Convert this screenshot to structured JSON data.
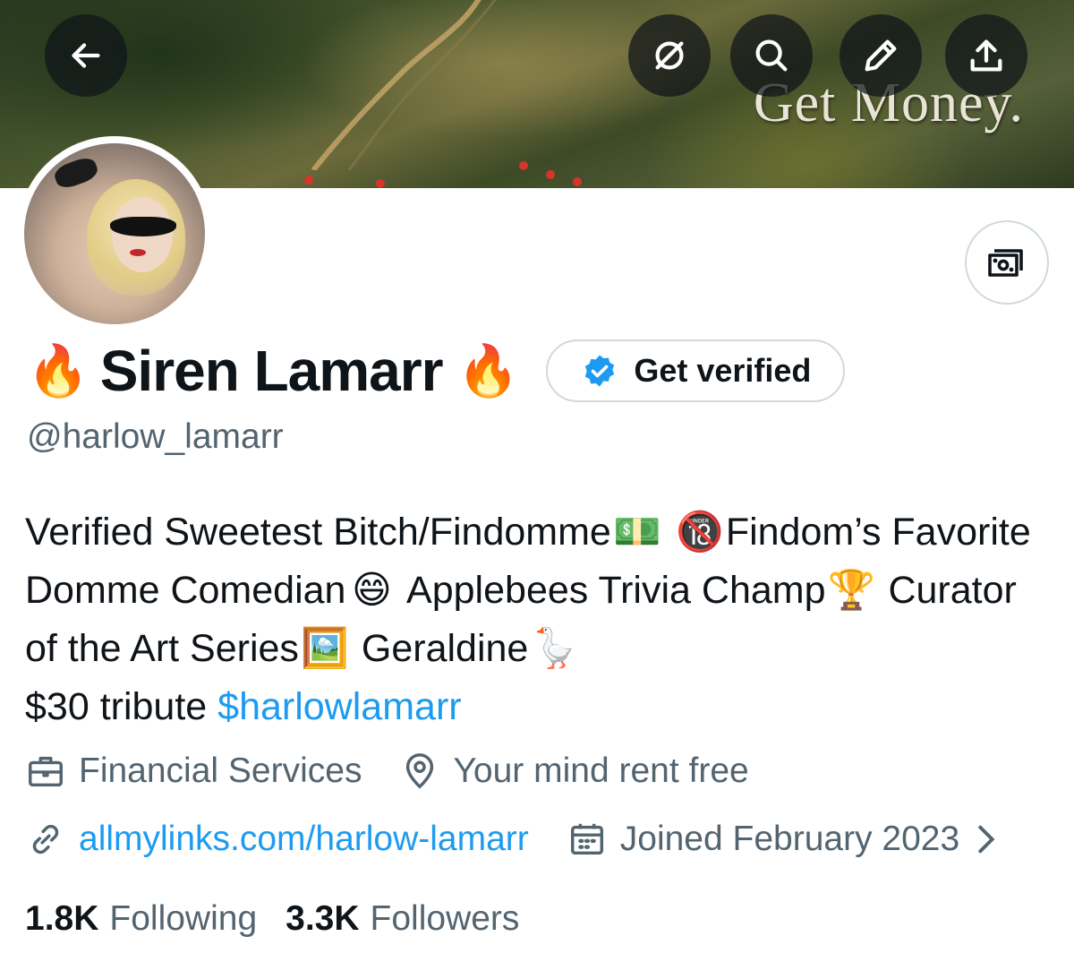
{
  "banner": {
    "overlay_text": "Get Money."
  },
  "toolbar": {
    "back_icon": "arrow-left-icon",
    "grok_icon": "grok-icon",
    "search_icon": "search-icon",
    "edit_icon": "pencil-icon",
    "share_icon": "share-icon"
  },
  "tip_icon": "money-icon",
  "profile": {
    "fire_emoji": "🔥",
    "display_name": "Siren Lamarr",
    "verify_button_label": "Get verified",
    "handle": "@harlow_lamarr",
    "bio": {
      "part1": "Verified Sweetest Bitch/Findomme",
      "emoji1": "💵",
      "emoji2": "🔞",
      "part2": "Findom’s Favorite Domme Comedian",
      "emoji3": "😄",
      "part3": "Applebees Trivia Champ",
      "emoji4": "🏆",
      "part4": "Curator of the Art Series",
      "emoji5": "🖼️",
      "part5": "Geraldine",
      "emoji6": "🪿",
      "part6": "$30 tribute",
      "cashtag": "$harlowlamarr"
    },
    "category": "Financial Services",
    "location": "Your mind rent free",
    "website": "allmylinks.com/harlow-lamarr",
    "joined": "Joined February 2023",
    "following_count": "1.8K",
    "following_label": "Following",
    "followers_count": "3.3K",
    "followers_label": "Followers"
  },
  "colors": {
    "link": "#1d9bf0",
    "secondary_text": "#536471",
    "primary_text": "#0f1419",
    "verified_badge": "#1d9bf0"
  }
}
